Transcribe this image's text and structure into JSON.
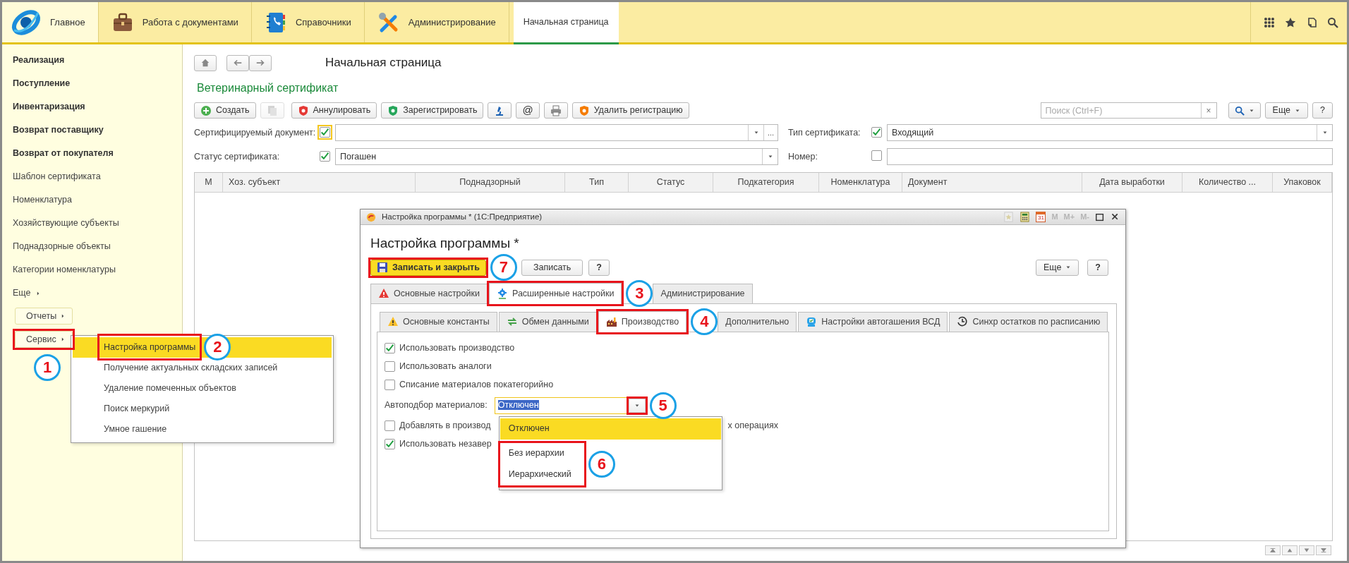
{
  "top_bar": {
    "sections": [
      {
        "label": "Главное",
        "selected": true
      },
      {
        "label": "Работа с документами",
        "selected": false
      },
      {
        "label": "Справочники",
        "selected": false
      },
      {
        "label": "Администрирование",
        "selected": false
      }
    ],
    "open_pages": [
      {
        "label": "Начальная страница",
        "selected": true
      }
    ]
  },
  "sidebar": {
    "items": [
      {
        "label": "Реализация",
        "kind": "section"
      },
      {
        "label": "Поступление",
        "kind": "section"
      },
      {
        "label": "Инвентаризация",
        "kind": "section"
      },
      {
        "label": "Возврат поставщику",
        "kind": "section"
      },
      {
        "label": "Возврат от покупателя",
        "kind": "section"
      },
      {
        "label": "Шаблон сертификата",
        "kind": "link"
      },
      {
        "label": "Номенклатура",
        "kind": "link"
      },
      {
        "label": "Хозяйствующие субъекты",
        "kind": "link"
      },
      {
        "label": "Поднадзорные объекты",
        "kind": "link"
      },
      {
        "label": "Категории номенклатуры",
        "kind": "link"
      },
      {
        "label": "Еще",
        "kind": "more"
      }
    ],
    "buttons": [
      {
        "label": "Отчеты",
        "highlighted": false
      },
      {
        "label": "Сервис",
        "highlighted": true,
        "callout": "1"
      }
    ]
  },
  "service_menu": {
    "items": [
      {
        "label": "Настройка программы",
        "selected": true,
        "highlighted": true,
        "callout": "2"
      },
      {
        "label": "Получение актуальных складских записей",
        "selected": false,
        "highlighted": false
      },
      {
        "label": "Удаление помеченных объектов",
        "selected": false,
        "highlighted": false
      },
      {
        "label": "Поиск меркурий",
        "selected": false,
        "highlighted": false
      },
      {
        "label": "Умное гашение",
        "selected": false,
        "highlighted": false
      }
    ]
  },
  "page": {
    "title": "Начальная страница",
    "form_title": "Ветеринарный сертификат",
    "toolbar": [
      {
        "label": "Создать",
        "disabled": false
      },
      {
        "disabled": true
      },
      {
        "label": "Аннулировать",
        "disabled": false
      },
      {
        "label": "Зарегистрировать",
        "disabled": false
      },
      {
        "disabled": false
      },
      {
        "label": "@",
        "disabled": false
      },
      {
        "disabled": false
      },
      {
        "label": "Удалить регистрацию",
        "disabled": false
      }
    ],
    "search": {
      "placeholder": "Поиск (Ctrl+F)",
      "clear": "×"
    },
    "more_button": "Еще",
    "help_button": "?",
    "filters": [
      {
        "label": "Сертифицируемый документ:",
        "checked": true,
        "focused": true,
        "kind": "choice",
        "extra_button": "..."
      },
      {
        "label": "Тип сертификата:",
        "checked": true,
        "focused": false,
        "kind": "choice",
        "value": "Входящий"
      },
      {
        "label": "Статус сертификата:",
        "checked": true,
        "focused": false,
        "kind": "choice",
        "value": "Погашен"
      },
      {
        "label": "Номер:",
        "checked": false,
        "focused": false,
        "kind": "text"
      }
    ],
    "table": {
      "columns": [
        "М",
        "Хоз. субъект",
        "Поднадзорный",
        "Тип",
        "Статус",
        "Подкатегория",
        "Номенклатура",
        "Документ",
        "Дата выработки",
        "Количество ...",
        "Упаковок"
      ]
    }
  },
  "dialog": {
    "title_bar": {
      "title": "Настройка программы * (1С:Предприятие)",
      "calendar_day": "31",
      "memory_buttons": [
        {
          "label": "M",
          "disabled": true
        },
        {
          "label": "M+",
          "disabled": true
        },
        {
          "label": "M-",
          "disabled": true
        }
      ]
    },
    "heading": "Настройка программы *",
    "commands": [
      {
        "label": "Записать и закрыть",
        "kind": "primary",
        "highlighted": true,
        "callout": "7"
      },
      {
        "label": "Записать",
        "kind": "default",
        "highlighted": false
      },
      {
        "label": "?",
        "kind": "help",
        "highlighted": false
      }
    ],
    "more_button": "Еще",
    "help_button": "?",
    "tabs": [
      {
        "label": "Основные настройки",
        "selected": false,
        "highlighted": false
      },
      {
        "label": "Расширенные настройки",
        "selected": true,
        "highlighted": true,
        "callout": "3"
      },
      {
        "label": "Администрирование",
        "selected": false,
        "highlighted": false
      }
    ],
    "subtabs": [
      {
        "label": "Основные константы",
        "selected": false,
        "highlighted": false
      },
      {
        "label": "Обмен данными",
        "selected": false,
        "highlighted": false
      },
      {
        "label": "Производство",
        "selected": true,
        "highlighted": true,
        "callout": "4"
      },
      {
        "label": "Дополнительно",
        "selected": false,
        "highlighted": false
      },
      {
        "label": "Настройки автогашения ВСД",
        "selected": false,
        "highlighted": false
      },
      {
        "label": "Синхр остатков по расписанию",
        "selected": false,
        "highlighted": false
      }
    ],
    "settings": [
      {
        "kind": "checkbox",
        "label": "Использовать производство",
        "checked": true
      },
      {
        "kind": "checkbox",
        "label": "Использовать аналоги",
        "checked": false
      },
      {
        "kind": "checkbox",
        "label": "Списание материалов покатегорийно",
        "checked": false
      },
      {
        "kind": "select",
        "label": "Автоподбор материалов:",
        "value": "Отключен",
        "highlighted": true,
        "callout": "5",
        "options_callout": "6",
        "options": [
          {
            "label": "Отключен",
            "selected": true,
            "highlighted": false
          },
          {
            "label": "Без иерархии",
            "selected": false,
            "highlighted": true
          },
          {
            "label": "Иерархический",
            "selected": false,
            "highlighted": true
          }
        ]
      },
      {
        "kind": "checkbox",
        "label": "Добавлять в производ",
        "label_end": "х операциях",
        "checked": false
      },
      {
        "kind": "checkbox",
        "label": "Использовать незавер",
        "checked": true
      }
    ]
  }
}
